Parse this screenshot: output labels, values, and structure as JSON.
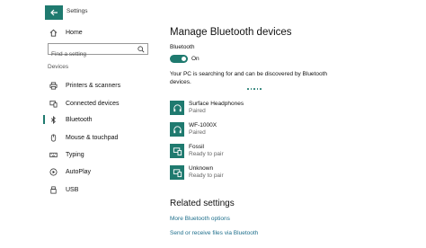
{
  "app": {
    "title": "Settings"
  },
  "colors": {
    "accent": "#1f7a6f",
    "link": "#1f6f8c"
  },
  "sidebar": {
    "home": {
      "label": "Home",
      "icon": "home-icon"
    },
    "search": {
      "placeholder": "Find a setting",
      "icon": "search-icon"
    },
    "section_label": "Devices",
    "items": [
      {
        "label": "Printers & scanners",
        "icon": "printer-icon",
        "selected": false
      },
      {
        "label": "Connected devices",
        "icon": "connected-devices-icon",
        "selected": false
      },
      {
        "label": "Bluetooth",
        "icon": "bluetooth-icon",
        "selected": true
      },
      {
        "label": "Mouse & touchpad",
        "icon": "mouse-icon",
        "selected": false
      },
      {
        "label": "Typing",
        "icon": "keyboard-icon",
        "selected": false
      },
      {
        "label": "AutoPlay",
        "icon": "autoplay-icon",
        "selected": false
      },
      {
        "label": "USB",
        "icon": "usb-icon",
        "selected": false
      }
    ]
  },
  "main": {
    "title": "Manage Bluetooth devices",
    "bluetooth_label": "Bluetooth",
    "toggle_state": "On",
    "discover_text": "Your PC is searching for and can be discovered by Bluetooth devices.",
    "devices": [
      {
        "name": "Surface Headphones",
        "status": "Paired",
        "icon": "headphones-icon"
      },
      {
        "name": "WF-1000X",
        "status": "Paired",
        "icon": "headphones-icon"
      },
      {
        "name": "Fossil",
        "status": "Ready to pair",
        "icon": "device-icon"
      },
      {
        "name": "Unknown",
        "status": "Ready to pair",
        "icon": "device-icon"
      }
    ],
    "related": {
      "title": "Related settings",
      "links": [
        "More Bluetooth options",
        "Send or receive files via Bluetooth"
      ]
    }
  }
}
